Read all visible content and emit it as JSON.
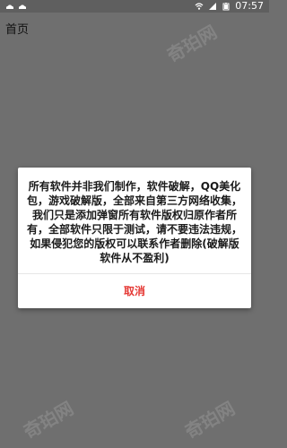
{
  "status_bar": {
    "time": "07:57",
    "left_icons": [
      "android-icon",
      "android-icon"
    ],
    "right_icons": [
      "wifi-icon",
      "signal-icon",
      "battery-icon"
    ]
  },
  "page": {
    "title": "首页"
  },
  "watermark": {
    "text": "奇珀网"
  },
  "dialog": {
    "message": "所有软件并非我们制作，软件破解，QQ美化包，游戏破解版，全部来自第三方网络收集，我们只是添加弹窗所有软件版权归原作者所有，全部软件只限于测试，请不要违法违规，如果侵犯您的版权可以联系作者删除(破解版软件从不盈利)",
    "cancel_label": "取消"
  },
  "colors": {
    "overlay_bg": "#6f6f6f",
    "status_bar_bg": "#5f5f5f",
    "dialog_bg": "#ffffff",
    "cancel_text": "#e53935"
  }
}
